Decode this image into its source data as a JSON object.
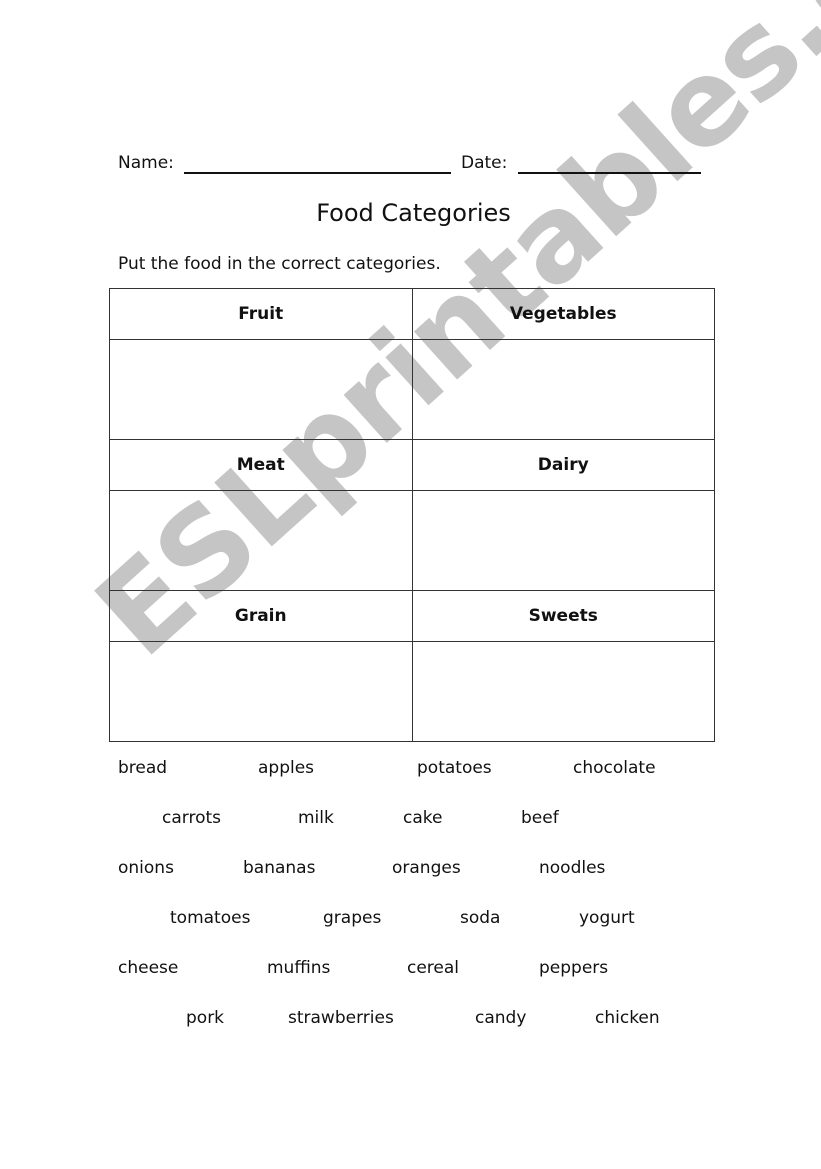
{
  "header": {
    "name_label": "Name:",
    "date_label": "Date:"
  },
  "title": "Food Categories",
  "instruction": "Put the food in the correct categories.",
  "categories": [
    "Fruit",
    "Vegetables",
    "Meat",
    "Dairy",
    "Grain",
    "Sweets"
  ],
  "word_bank": [
    [
      "bread",
      "apples",
      "potatoes",
      "chocolate"
    ],
    [
      "carrots",
      "milk",
      "cake",
      "beef"
    ],
    [
      "onions",
      "bananas",
      "oranges",
      "noodles"
    ],
    [
      "tomatoes",
      "grapes",
      "soda",
      "yogurt"
    ],
    [
      "cheese",
      "muffins",
      "cereal",
      "peppers"
    ],
    [
      "pork",
      "strawberries",
      "candy",
      "chicken"
    ]
  ],
  "watermark": "ESLprintables.com"
}
